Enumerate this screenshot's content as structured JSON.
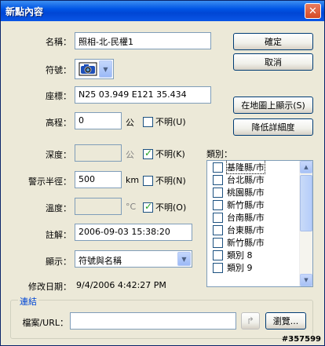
{
  "window": {
    "title": "新點內容",
    "close_label": "✕"
  },
  "fields": {
    "name_label": "名稱：",
    "name_value": "照相-北-民權1",
    "symbol_label": "符號：",
    "coord_label": "座標：",
    "coord_value": "N25 03.949 E121 35.434",
    "elevation_label": "高程：",
    "elevation_value": "0",
    "elevation_unit": "公",
    "elevation_unknown": "不明(U)",
    "depth_label": "深度：",
    "depth_value": "",
    "depth_unit": "公",
    "depth_unknown": "不明(K)",
    "radius_label": "警示半徑：",
    "radius_value": "500",
    "radius_unit": "km",
    "radius_unknown": "不明(N)",
    "temp_label": "溫度：",
    "temp_value": "",
    "temp_unit": "°C",
    "temp_unknown": "不明(O)",
    "comment_label": "註解：",
    "comment_value": "2006-09-03 15:38:20",
    "display_label": "顯示：",
    "display_value": "符號與名稱",
    "modified_label": "修改日期：",
    "modified_value": "9/4/2006 4:42:27 PM"
  },
  "checkbox_state": {
    "elevation_unknown": false,
    "depth_unknown": true,
    "radius_unknown": false,
    "temp_unknown": true
  },
  "buttons": {
    "ok": "確定",
    "cancel": "取消",
    "show_on_map": "在地圖上顯示(S)",
    "lower_detail": "降低詳細度",
    "browse": "瀏覽..."
  },
  "category": {
    "label": "類別：",
    "items": [
      {
        "label": "基隆縣/市",
        "checked": false,
        "selected": true
      },
      {
        "label": "台北縣/市",
        "checked": false
      },
      {
        "label": "桃園縣/市",
        "checked": false
      },
      {
        "label": "新竹縣/市",
        "checked": false
      },
      {
        "label": "台南縣/市",
        "checked": false
      },
      {
        "label": "台東縣/市",
        "checked": false
      },
      {
        "label": "新竹縣/市",
        "checked": false
      },
      {
        "label": "類別 8",
        "checked": false
      },
      {
        "label": "類別 9",
        "checked": false
      }
    ]
  },
  "link": {
    "group_title": "連結",
    "file_label": "檔案/URL：",
    "file_value": ""
  },
  "watermark": "#357599",
  "colors": {
    "titlebar": "#0055e5",
    "window_bg": "#ece9d8",
    "link_title": "#0046d5"
  }
}
